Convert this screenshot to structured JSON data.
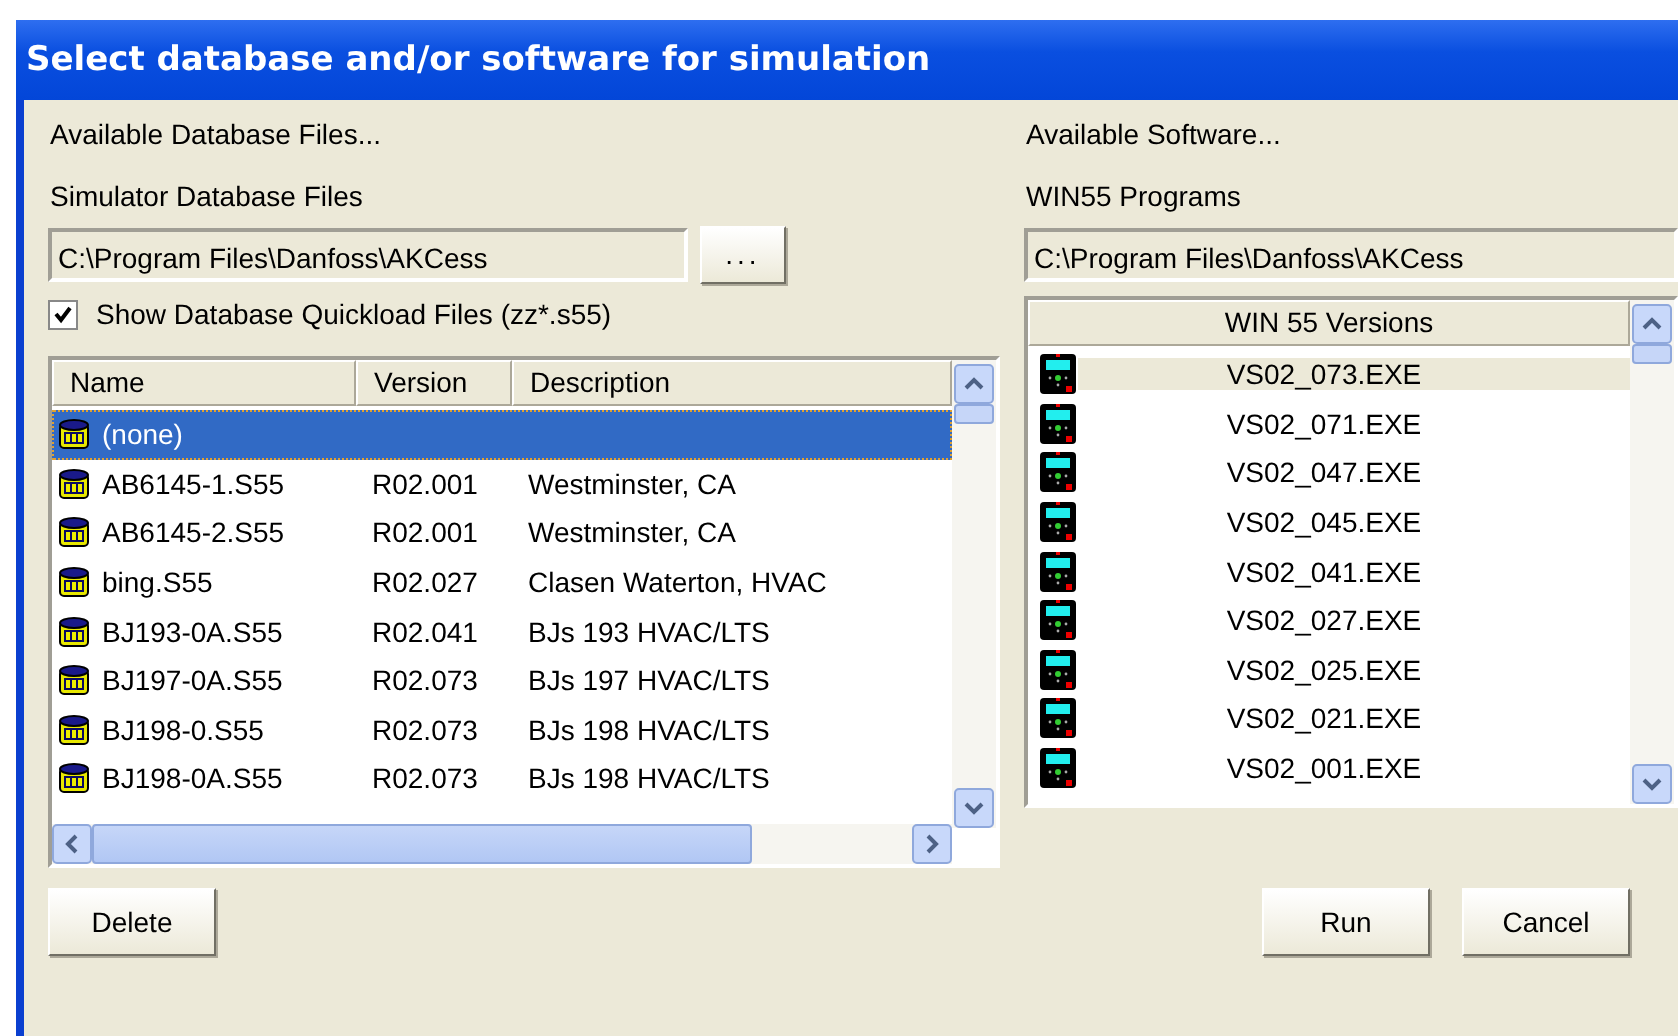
{
  "window": {
    "title": "Select database and/or software for simulation"
  },
  "database": {
    "heading": "Available Database Files...",
    "label": "Simulator Database Files",
    "path": "C:\\Program Files\\Danfoss\\AKCess",
    "browse": "...",
    "quickload": {
      "label": "Show Database Quickload Files (zz*.s55)",
      "checked": true
    },
    "columns": [
      "Name",
      "Version",
      "Description"
    ],
    "rows": [
      {
        "name": "(none)",
        "version": "",
        "description": "",
        "selected": true
      },
      {
        "name": "AB6145-1.S55",
        "version": "R02.001",
        "description": "Westminster, CA",
        "selected": false
      },
      {
        "name": "AB6145-2.S55",
        "version": "R02.001",
        "description": "Westminster, CA",
        "selected": false
      },
      {
        "name": "bing.S55",
        "version": "R02.027",
        "description": "Clasen Waterton, HVAC",
        "selected": false
      },
      {
        "name": "BJ193-0A.S55",
        "version": "R02.041",
        "description": "BJs 193 HVAC/LTS",
        "selected": false
      },
      {
        "name": "BJ197-0A.S55",
        "version": "R02.073",
        "description": "BJs 197 HVAC/LTS",
        "selected": false
      },
      {
        "name": "BJ198-0.S55",
        "version": "R02.073",
        "description": "BJs 198 HVAC/LTS",
        "selected": false
      },
      {
        "name": "BJ198-0A.S55",
        "version": "R02.073",
        "description": "BJs 198 HVAC/LTS",
        "selected": false
      }
    ]
  },
  "software": {
    "heading": "Available Software...",
    "label": "WIN55 Programs",
    "path": "C:\\Program Files\\Danfoss\\AKCess",
    "column": "WIN 55 Versions",
    "rows": [
      {
        "name": "VS02_073.EXE",
        "selected": true
      },
      {
        "name": "VS02_071.EXE",
        "selected": false
      },
      {
        "name": "VS02_047.EXE",
        "selected": false
      },
      {
        "name": "VS02_045.EXE",
        "selected": false
      },
      {
        "name": "VS02_041.EXE",
        "selected": false
      },
      {
        "name": "VS02_027.EXE",
        "selected": false
      },
      {
        "name": "VS02_025.EXE",
        "selected": false
      },
      {
        "name": "VS02_021.EXE",
        "selected": false
      },
      {
        "name": "VS02_001.EXE",
        "selected": false
      }
    ]
  },
  "buttons": {
    "left": [
      "Delete"
    ],
    "right": [
      "Run",
      "Cancel"
    ]
  }
}
